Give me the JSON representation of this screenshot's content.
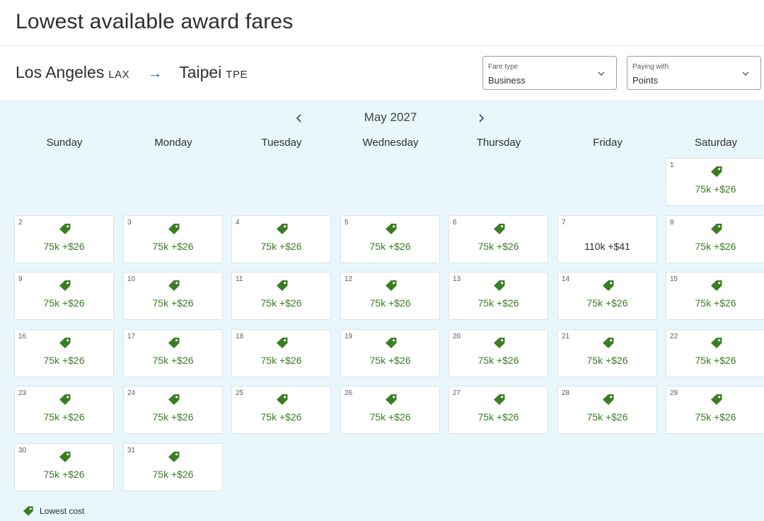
{
  "page": {
    "title": "Lowest available award fares"
  },
  "route": {
    "origin_city": "Los Angeles",
    "origin_code": "LAX",
    "arrow": "→",
    "destination_city": "Taipei",
    "destination_code": "TPE"
  },
  "filters": {
    "fare_type": {
      "label": "Fare type",
      "value": "Business"
    },
    "paying_with": {
      "label": "Paying with",
      "value": "Points"
    }
  },
  "calendar": {
    "month": "May 2027",
    "weekdays": [
      "Sunday",
      "Monday",
      "Tuesday",
      "Wednesday",
      "Thursday",
      "Friday",
      "Saturday"
    ],
    "days": [
      {
        "day": "1",
        "price": "75k +$26",
        "lowest": true
      },
      {
        "day": "2",
        "price": "75k +$26",
        "lowest": true
      },
      {
        "day": "3",
        "price": "75k +$26",
        "lowest": true
      },
      {
        "day": "4",
        "price": "75k +$26",
        "lowest": true
      },
      {
        "day": "5",
        "price": "75k +$26",
        "lowest": true
      },
      {
        "day": "6",
        "price": "75k +$26",
        "lowest": true
      },
      {
        "day": "7",
        "price": "110k +$41",
        "lowest": false
      },
      {
        "day": "8",
        "price": "75k +$26",
        "lowest": true
      },
      {
        "day": "9",
        "price": "75k +$26",
        "lowest": true
      },
      {
        "day": "10",
        "price": "75k +$26",
        "lowest": true
      },
      {
        "day": "11",
        "price": "75k +$26",
        "lowest": true
      },
      {
        "day": "12",
        "price": "75k +$26",
        "lowest": true
      },
      {
        "day": "13",
        "price": "75k +$26",
        "lowest": true
      },
      {
        "day": "14",
        "price": "75k +$26",
        "lowest": true
      },
      {
        "day": "15",
        "price": "75k +$26",
        "lowest": true
      },
      {
        "day": "16",
        "price": "75k +$26",
        "lowest": true
      },
      {
        "day": "17",
        "price": "75k +$26",
        "lowest": true
      },
      {
        "day": "18",
        "price": "75k +$26",
        "lowest": true
      },
      {
        "day": "19",
        "price": "75k +$26",
        "lowest": true
      },
      {
        "day": "20",
        "price": "75k +$26",
        "lowest": true
      },
      {
        "day": "21",
        "price": "75k +$26",
        "lowest": true
      },
      {
        "day": "22",
        "price": "75k +$26",
        "lowest": true
      },
      {
        "day": "23",
        "price": "75k +$26",
        "lowest": true
      },
      {
        "day": "24",
        "price": "75k +$26",
        "lowest": true
      },
      {
        "day": "25",
        "price": "75k +$26",
        "lowest": true
      },
      {
        "day": "26",
        "price": "75k +$26",
        "lowest": true
      },
      {
        "day": "27",
        "price": "75k +$26",
        "lowest": true
      },
      {
        "day": "28",
        "price": "75k +$26",
        "lowest": true
      },
      {
        "day": "29",
        "price": "75k +$26",
        "lowest": true
      },
      {
        "day": "30",
        "price": "75k +$26",
        "lowest": true
      },
      {
        "day": "31",
        "price": "75k +$26",
        "lowest": true
      }
    ]
  },
  "legend": {
    "label": "Lowest cost",
    "icon": "price-tag-icon"
  },
  "colors": {
    "lowest_price": "#3b7d23",
    "tag_icon": "#3b7d23",
    "calendar_background": "#e9f7fc",
    "arrow": "#1b6aa5"
  }
}
